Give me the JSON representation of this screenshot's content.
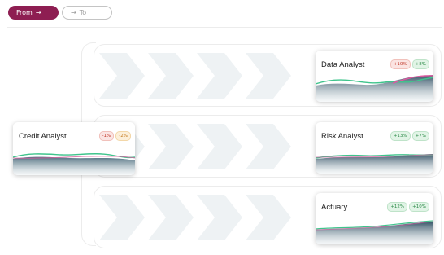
{
  "toggle": {
    "from_label": "From",
    "to_label": "To"
  },
  "source_role": {
    "title": "Credit Analyst",
    "badges": [
      {
        "text": "-1%",
        "tone": "red"
      },
      {
        "text": "-2%",
        "tone": "orange"
      }
    ]
  },
  "target_roles": [
    {
      "title": "Data Analyst",
      "badges": [
        {
          "text": "+10%",
          "tone": "red"
        },
        {
          "text": "+8%",
          "tone": "green"
        }
      ]
    },
    {
      "title": "Risk Analyst",
      "badges": [
        {
          "text": "+13%",
          "tone": "green"
        },
        {
          "text": "+7%",
          "tone": "green"
        }
      ]
    },
    {
      "title": "Actuary",
      "badges": [
        {
          "text": "+12%",
          "tone": "green"
        },
        {
          "text": "+10%",
          "tone": "green"
        }
      ]
    }
  ],
  "colors": {
    "brand": "#8e1e52",
    "trend_green": "#3fc48c",
    "trend_pink": "#d95a9e",
    "trend_navy": "#2a4a5e"
  }
}
